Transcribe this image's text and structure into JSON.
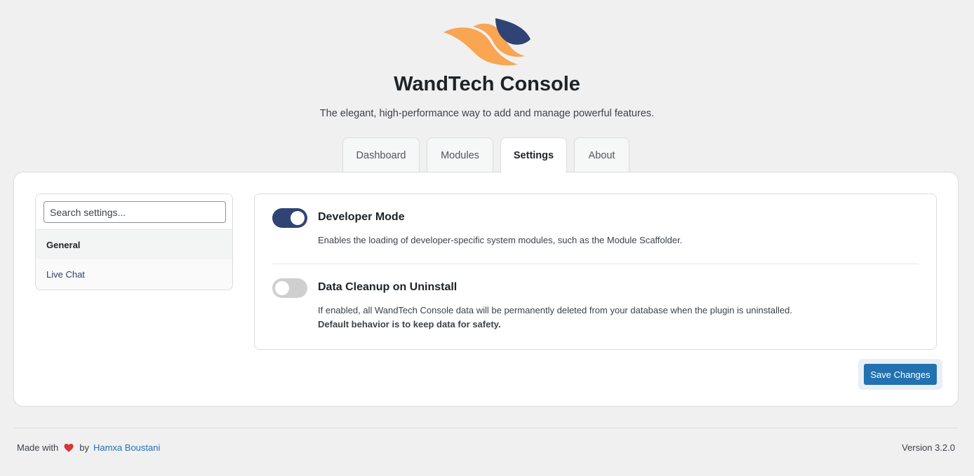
{
  "app": {
    "title": "WandTech Console",
    "subtitle": "The elegant, high-performance way to add and manage powerful features."
  },
  "tabs": [
    {
      "label": "Dashboard",
      "active": false
    },
    {
      "label": "Modules",
      "active": false
    },
    {
      "label": "Settings",
      "active": true
    },
    {
      "label": "About",
      "active": false
    }
  ],
  "sidebar": {
    "search_placeholder": "Search settings...",
    "items": [
      {
        "label": "General",
        "active": true
      },
      {
        "label": "Live Chat",
        "active": false
      }
    ]
  },
  "settings": [
    {
      "title": "Developer Mode",
      "enabled": true,
      "description": "Enables the loading of developer-specific system modules, such as the Module Scaffolder.",
      "note": ""
    },
    {
      "title": "Data Cleanup on Uninstall",
      "enabled": false,
      "description": "If enabled, all WandTech Console data will be permanently deleted from your database when the plugin is uninstalled.",
      "note": "Default behavior is to keep data for safety."
    }
  ],
  "actions": {
    "save_label": "Save Changes"
  },
  "footer": {
    "made_with": "Made with",
    "by": "by",
    "author": "Hamxa Boustani",
    "version": "Version 3.2.0"
  },
  "colors": {
    "accent": "#2271b1",
    "toggle_on": "#2f4475",
    "toggle_off": "#cfcfcf",
    "logo_orange": "#f9a552",
    "logo_navy": "#2f4475",
    "heart": "#d63638"
  },
  "icons": {
    "logo": "wandtech-logo",
    "heart": "heart-icon"
  }
}
